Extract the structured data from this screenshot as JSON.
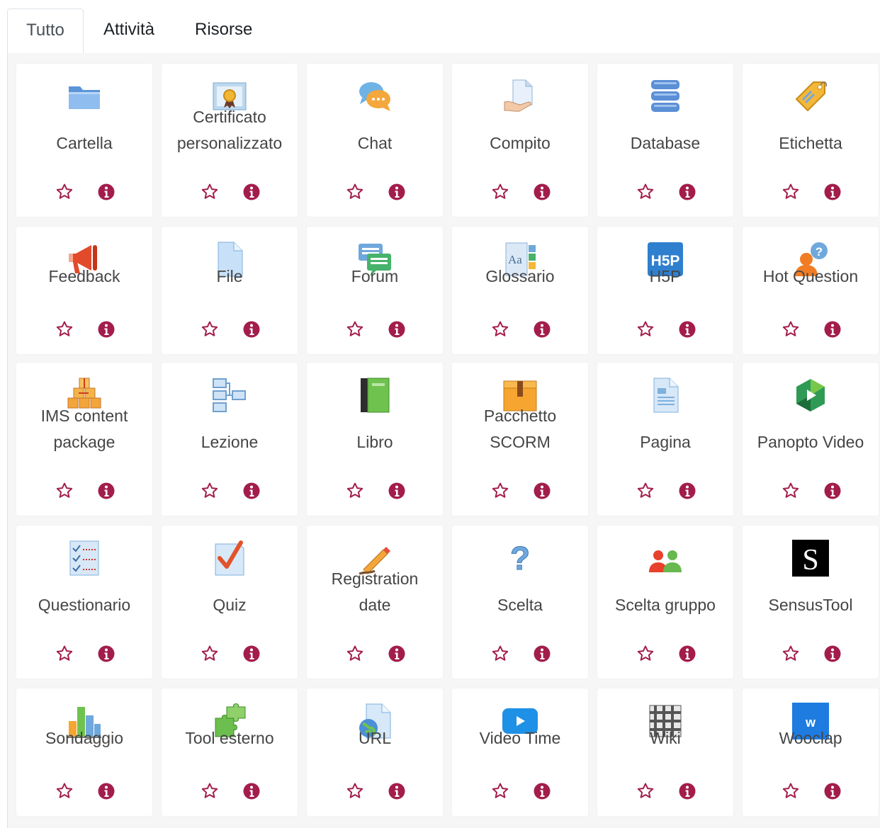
{
  "tabs": [
    {
      "label": "Tutto",
      "active": true
    },
    {
      "label": "Attività",
      "active": false
    },
    {
      "label": "Risorse",
      "active": false
    }
  ],
  "colors": {
    "accent": "#a31d4c",
    "tab_border": "#dee2e6",
    "panel_bg": "#f6f6f6"
  },
  "rows": [
    [
      {
        "label": [
          "Cartella"
        ],
        "icon": "folder-icon"
      },
      {
        "label": [
          "Certificato",
          "personalizzato"
        ],
        "icon": "certificate-icon"
      },
      {
        "label": [
          "Chat"
        ],
        "icon": "chat-icon"
      },
      {
        "label": [
          "Compito"
        ],
        "icon": "assignment-icon"
      },
      {
        "label": [
          "Database"
        ],
        "icon": "database-icon"
      },
      {
        "label": [
          "Etichetta"
        ],
        "icon": "label-tag-icon"
      }
    ],
    [
      {
        "label": [
          "Feedback"
        ],
        "icon": "megaphone-icon"
      },
      {
        "label": [
          "File"
        ],
        "icon": "file-icon"
      },
      {
        "label": [
          "Forum"
        ],
        "icon": "forum-icon"
      },
      {
        "label": [
          "Glossario"
        ],
        "icon": "glossary-icon"
      },
      {
        "label": [
          "H5P"
        ],
        "icon": "h5p-icon"
      },
      {
        "label": [
          "Hot Question"
        ],
        "icon": "hot-question-icon"
      }
    ],
    [
      {
        "label": [
          "IMS content",
          "package"
        ],
        "icon": "ims-package-icon"
      },
      {
        "label": [
          "Lezione"
        ],
        "icon": "lesson-icon"
      },
      {
        "label": [
          "Libro"
        ],
        "icon": "book-icon"
      },
      {
        "label": [
          "Pacchetto",
          "SCORM"
        ],
        "icon": "scorm-package-icon"
      },
      {
        "label": [
          "Pagina"
        ],
        "icon": "page-icon"
      },
      {
        "label": [
          "Panopto Video"
        ],
        "icon": "panopto-icon"
      }
    ],
    [
      {
        "label": [
          "Questionario"
        ],
        "icon": "questionnaire-icon"
      },
      {
        "label": [
          "Quiz"
        ],
        "icon": "quiz-icon"
      },
      {
        "label": [
          "Registration",
          "date"
        ],
        "icon": "pencil-icon"
      },
      {
        "label": [
          "Scelta"
        ],
        "icon": "question-mark-icon"
      },
      {
        "label": [
          "Scelta gruppo"
        ],
        "icon": "group-choice-icon"
      },
      {
        "label": [
          "SensusTool"
        ],
        "icon": "sensustool-icon"
      }
    ],
    [
      {
        "label": [
          "Sondaggio"
        ],
        "icon": "bar-chart-icon"
      },
      {
        "label": [
          "Tool esterno"
        ],
        "icon": "puzzle-icon"
      },
      {
        "label": [
          "URL"
        ],
        "icon": "url-globe-icon"
      },
      {
        "label": [
          "Video Time"
        ],
        "icon": "video-play-icon"
      },
      {
        "label": [
          "Wiki"
        ],
        "icon": "wiki-icon"
      },
      {
        "label": [
          "Wooclap"
        ],
        "icon": "wooclap-icon"
      }
    ]
  ]
}
